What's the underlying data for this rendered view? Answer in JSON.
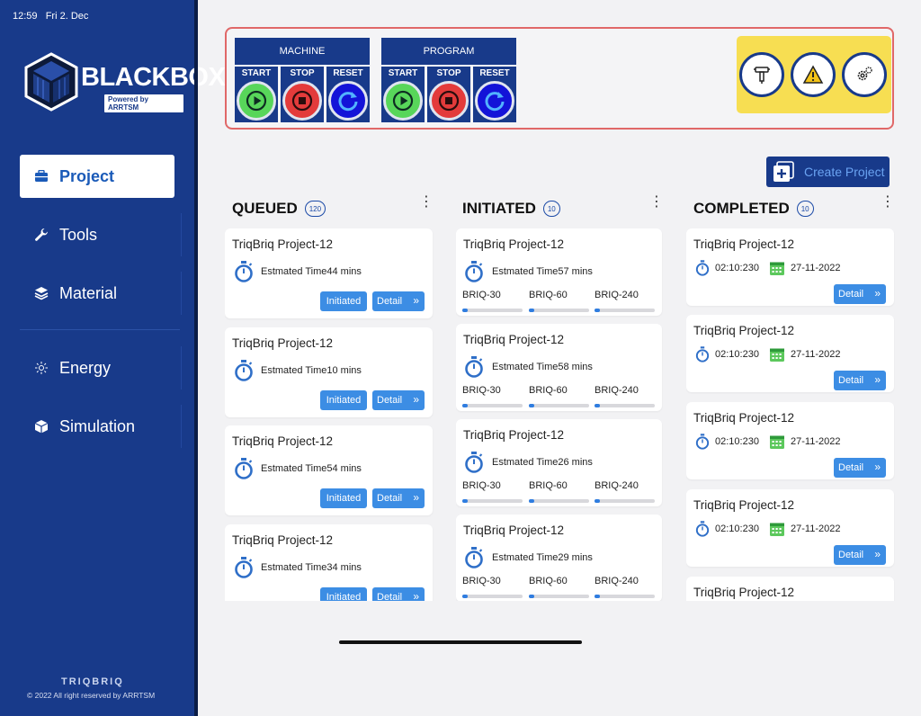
{
  "status": {
    "time": "12:59",
    "date": "Fri 2. Dec"
  },
  "brand": {
    "name": "BLACKBOX",
    "tagline": "Powered by ARRTSM"
  },
  "sidebar": {
    "items": [
      {
        "label": "Project",
        "icon": "briefcase-icon"
      },
      {
        "label": "Tools",
        "icon": "wrench-icon"
      },
      {
        "label": "Material",
        "icon": "layers-icon"
      },
      {
        "label": "Energy",
        "icon": "sun-icon"
      },
      {
        "label": "Simulation",
        "icon": "cube-box-icon"
      }
    ],
    "footer_brand": "TRIQBRIQ",
    "footer_copy": "© 2022 All right reserved by ARRTSM"
  },
  "controls": {
    "machine": {
      "title": "MACHINE",
      "start": "START",
      "stop": "STOP",
      "reset": "RESET"
    },
    "program": {
      "title": "PROGRAM",
      "start": "START",
      "stop": "STOP",
      "reset": "RESET"
    }
  },
  "create_button": "Create Project",
  "columns": {
    "queued": {
      "title": "QUEUED",
      "count": "120",
      "cards": [
        {
          "title": "TriqBriq Project-12",
          "time": "Estmated Time44 mins",
          "status": "Initiated",
          "detail": "Detail"
        },
        {
          "title": "TriqBriq Project-12",
          "time": "Estmated Time10 mins",
          "status": "Initiated",
          "detail": "Detail"
        },
        {
          "title": "TriqBriq Project-12",
          "time": "Estmated Time54 mins",
          "status": "Initiated",
          "detail": "Detail"
        },
        {
          "title": "TriqBriq Project-12",
          "time": "Estmated Time34 mins",
          "status": "Initiated",
          "detail": "Detail"
        }
      ]
    },
    "initiated": {
      "title": "INITIATED",
      "count": "10",
      "cards": [
        {
          "title": "TriqBriq Project-12",
          "time": "Estmated Time57 mins",
          "briqs": [
            "BRIQ-30",
            "BRIQ-60",
            "BRIQ-240"
          ]
        },
        {
          "title": "TriqBriq Project-12",
          "time": "Estmated Time58 mins",
          "briqs": [
            "BRIQ-30",
            "BRIQ-60",
            "BRIQ-240"
          ]
        },
        {
          "title": "TriqBriq Project-12",
          "time": "Estmated Time26 mins",
          "briqs": [
            "BRIQ-30",
            "BRIQ-60",
            "BRIQ-240"
          ]
        },
        {
          "title": "TriqBriq Project-12",
          "time": "Estmated Time29 mins",
          "briqs": [
            "BRIQ-30",
            "BRIQ-60",
            "BRIQ-240"
          ]
        }
      ]
    },
    "completed": {
      "title": "COMPLETED",
      "count": "10",
      "cards": [
        {
          "title": "TriqBriq Project-12",
          "duration": "02:10:230",
          "date": "27-11-2022",
          "detail": "Detail"
        },
        {
          "title": "TriqBriq Project-12",
          "duration": "02:10:230",
          "date": "27-11-2022",
          "detail": "Detail"
        },
        {
          "title": "TriqBriq Project-12",
          "duration": "02:10:230",
          "date": "27-11-2022",
          "detail": "Detail"
        },
        {
          "title": "TriqBriq Project-12",
          "duration": "02:10:230",
          "date": "27-11-2022",
          "detail": "Detail"
        },
        {
          "title": "TriqBriq Project-12"
        }
      ]
    }
  },
  "colors": {
    "sidebar": "#183a8a",
    "accent": "#3c8de4",
    "panel_border": "#e06868",
    "tools_bg": "#f7de52"
  }
}
